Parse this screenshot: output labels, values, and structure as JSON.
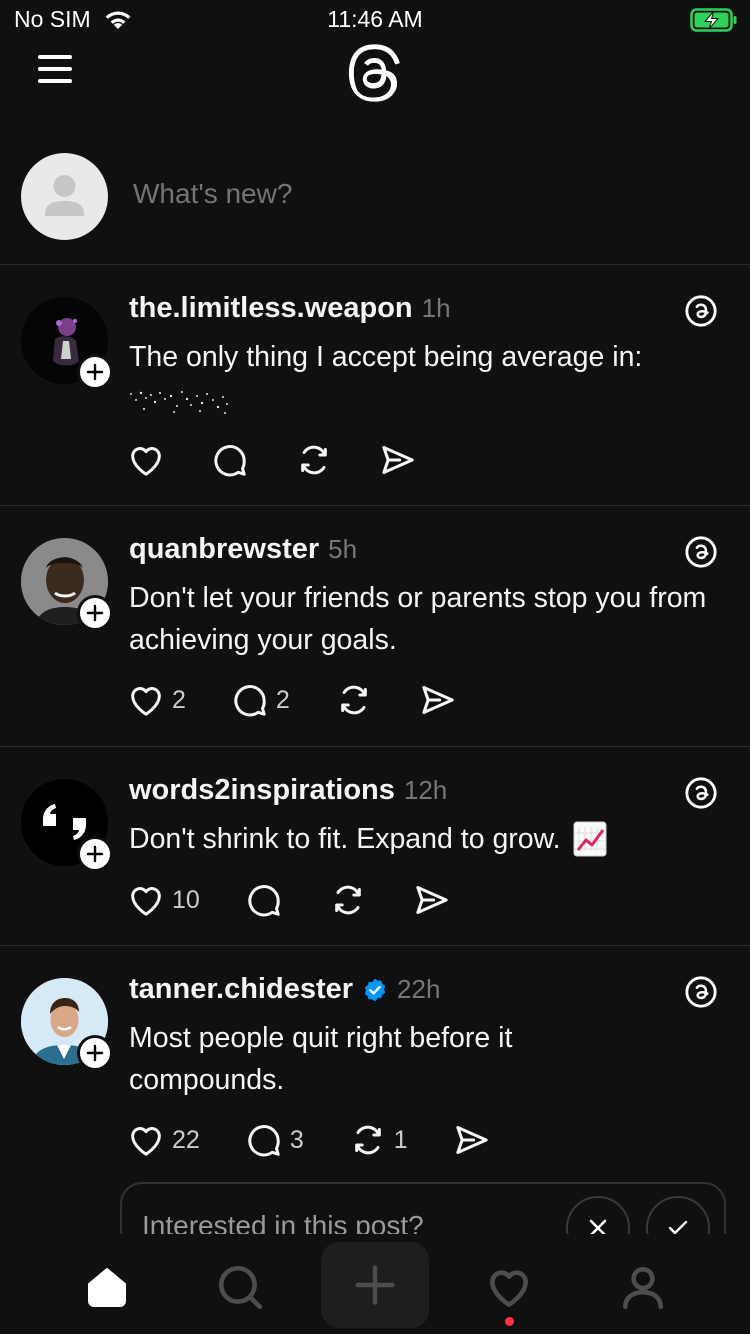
{
  "status_bar": {
    "carrier": "No SIM",
    "time": "11:46 AM",
    "battery_color": "#30d158"
  },
  "composer": {
    "placeholder": "What's new?"
  },
  "posts": [
    {
      "username": "the.limitless.weapon",
      "time": "1h",
      "text": "The only thing I accept being average in:",
      "verified": false,
      "likes": "",
      "replies": "",
      "reposts": ""
    },
    {
      "username": "quanbrewster",
      "time": "5h",
      "text": "Don't let your friends or parents stop you from achieving your goals.",
      "verified": false,
      "likes": "2",
      "replies": "2",
      "reposts": ""
    },
    {
      "username": "words2inspirations",
      "time": "12h",
      "text": "Don't shrink to fit. Expand to grow.",
      "verified": false,
      "likes": "10",
      "replies": "",
      "reposts": ""
    },
    {
      "username": "tanner.chidester",
      "time": "22h",
      "text": "Most people quit right before it compounds.",
      "verified": true,
      "likes": "22",
      "replies": "3",
      "reposts": "1"
    }
  ],
  "interest_card": {
    "prompt": "Interested in this post?"
  },
  "tab_bar": {
    "tabs": [
      "home-icon",
      "search-icon",
      "compose-icon",
      "heart-icon",
      "profile-icon"
    ],
    "notification_color": "#ff3040"
  },
  "colors": {
    "background": "#101010",
    "text": "#f3f5f7",
    "muted": "#777777",
    "verified": "#0095f6"
  }
}
